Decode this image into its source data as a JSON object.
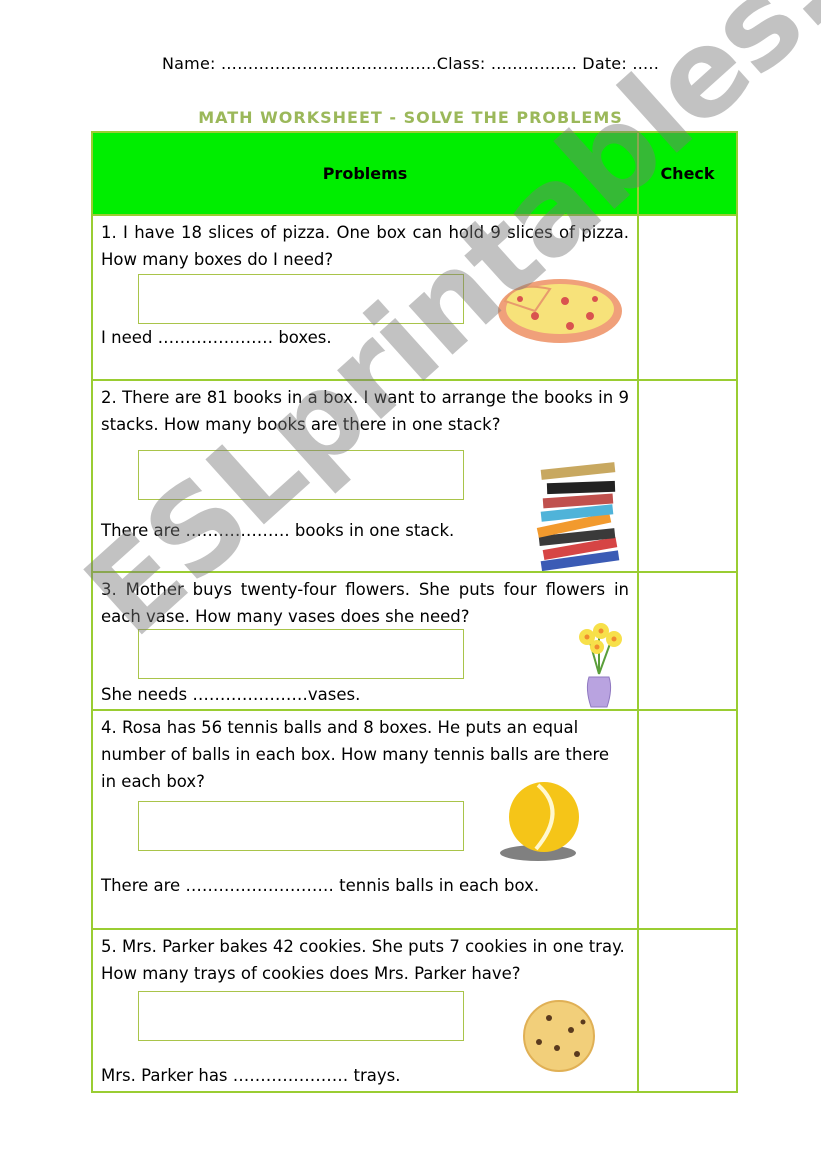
{
  "header": {
    "name_line": "Name: ………………………………….Class: ……………. Date: ….."
  },
  "title": "MATH WORKSHEET -  SOLVE THE PROBLEMS",
  "table": {
    "columns": [
      "Problems",
      "Check"
    ],
    "rows": [
      {
        "question": "1. I have 18 slices of pizza. One box can hold 9 slices of pizza. How many boxes do I need?",
        "answer_line": "I need ………………… boxes.",
        "icon": "pizza-icon"
      },
      {
        "question": "2. There are 81 books in a box. I want to arrange the books in 9 stacks. How many books are there in one stack?",
        "answer_line": "There are ………………. books in one stack.",
        "icon": "books-icon"
      },
      {
        "question": "3. Mother buys twenty-four flowers. She puts four flowers in each vase. How many vases does she need?",
        "answer_line": "She needs …………………vases.",
        "icon": "flower-vase-icon"
      },
      {
        "question": "4. Rosa has 56 tennis balls and 8 boxes. He puts an equal number of balls in each box. How many tennis balls are there in each box?",
        "answer_line": "There are ……………………… tennis balls in each box.",
        "icon": "tennis-ball-icon"
      },
      {
        "question": "5. Mrs. Parker bakes 42 cookies. She puts 7 cookies in one tray. How many trays of cookies does Mrs. Parker have?",
        "answer_line": "Mrs. Parker has  ………………… trays.",
        "icon": "cookie-icon"
      }
    ]
  },
  "watermark": "ESLprintables.com",
  "colors": {
    "header_fill": "#00ee00",
    "border": "#9acd32",
    "title": "#9bb85a"
  }
}
